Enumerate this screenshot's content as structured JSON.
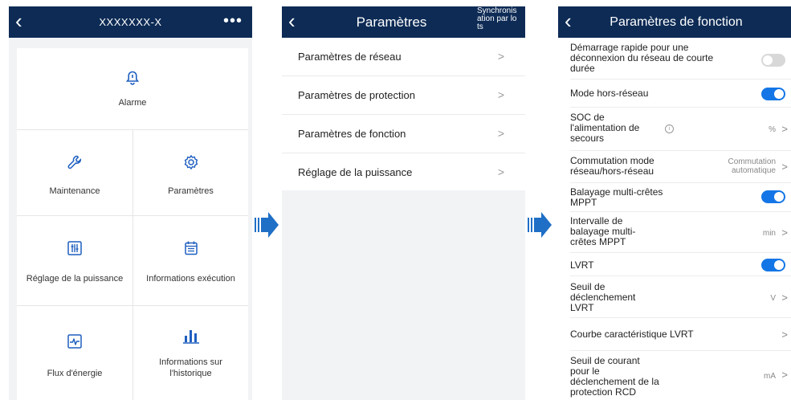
{
  "colors": {
    "header": "#0d2b55",
    "accent": "#1476e6",
    "toggle_off": "#d8d8d8",
    "arrow": "#1f6fc6"
  },
  "screen1": {
    "title": "XXXXXXX-X",
    "back_icon": "chevron-left-icon",
    "more_label": "•••",
    "tiles": [
      {
        "label": "Alarme",
        "icon": "bell-icon"
      },
      {
        "label": "Maintenance",
        "icon": "wrench-icon"
      },
      {
        "label": "Paramètres",
        "icon": "gear-icon"
      },
      {
        "label": "Réglage de la puissance",
        "icon": "sliders-icon"
      },
      {
        "label": "Informations exécution",
        "icon": "calendar-list-icon"
      },
      {
        "label": "Flux d'énergie",
        "icon": "energy-flow-icon"
      },
      {
        "label": "Informations sur l'historique",
        "icon": "bar-chart-icon"
      }
    ]
  },
  "screen2": {
    "title": "Paramètres",
    "sync_label": "Synchronisation par lots",
    "items": [
      {
        "label": "Paramètres de réseau"
      },
      {
        "label": "Paramètres de protection"
      },
      {
        "label": "Paramètres de fonction"
      },
      {
        "label": "Réglage de la puissance"
      }
    ],
    "chevron": ">"
  },
  "screen3": {
    "title": "Paramètres de fonction",
    "rows": {
      "quick_start": {
        "label": "Démarrage rapide pour une déconnexion du réseau de courte durée",
        "toggle": false
      },
      "off_grid": {
        "label": "Mode hors-réseau",
        "toggle": true
      },
      "soc": {
        "label": "SOC de l'alimentation de secours",
        "value": "%"
      },
      "switching": {
        "label": "Commutation mode réseau/hors-réseau",
        "value": "Commutation automatique"
      },
      "mppt_scan": {
        "label": "Balayage multi-crêtes MPPT",
        "toggle": true
      },
      "mppt_interval": {
        "label": "Intervalle de balayage multi-crêtes MPPT",
        "value": "min"
      },
      "lvrt": {
        "label": "LVRT",
        "toggle": true
      },
      "lvrt_threshold": {
        "label": "Seuil de déclenchement LVRT",
        "value": "V"
      },
      "lvrt_curve": {
        "label": "Courbe caractéristique LVRT"
      },
      "rcd": {
        "label": "Seuil de courant pour le déclenchement de la protection RCD",
        "value": "mA"
      }
    },
    "chevron": ">"
  }
}
